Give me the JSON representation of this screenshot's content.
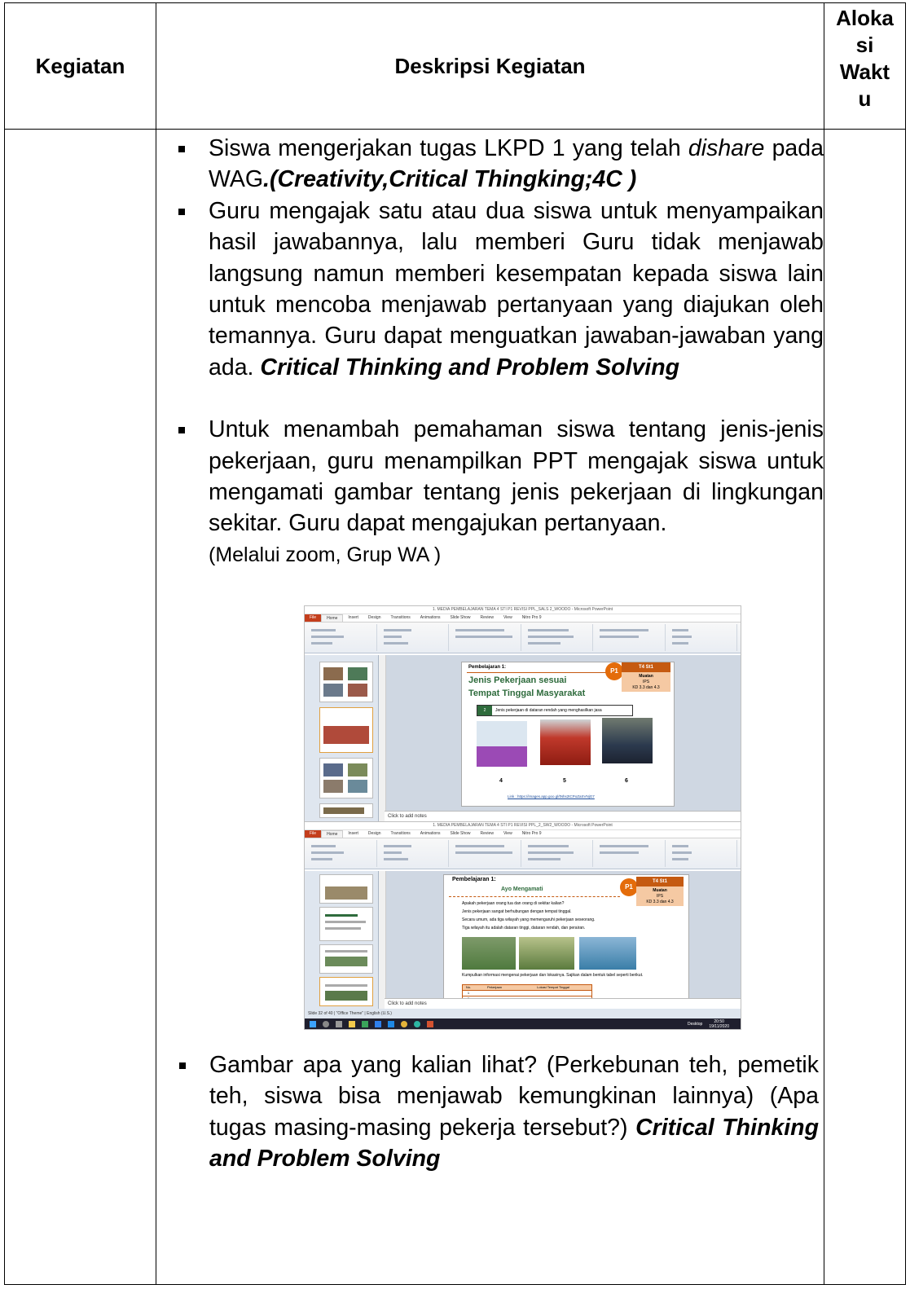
{
  "table": {
    "headers": {
      "kegiatan": "Kegiatan",
      "deskripsi": "Deskripsi Kegiatan",
      "alokasi": [
        "Aloka",
        "si",
        "Wakt",
        "u"
      ]
    },
    "items": {
      "item1": {
        "text1": "Siswa mengerjakan tugas LKPD 1 yang telah ",
        "italic": "dishare",
        "text2": " pada WAG",
        "bold_italic": ".(Creativity,Critical Thingking;4C )"
      },
      "item2": {
        "text": "Guru mengajak satu atau dua siswa untuk menyampaikan hasil jawabannya, lalu memberi Guru tidak menjawab langsung namun memberi kesempatan kepada siswa lain untuk mencoba menjawab pertanyaan yang diajukan oleh temannya. Guru dapat menguatkan jawaban-jawaban yang ada. ",
        "bold_italic": "Critical Thinking and Problem Solving"
      },
      "item3": {
        "text": "Untuk menambah pemahaman siswa tentang jenis-jenis pekerjaan, guru menampilkan PPT mengajak siswa untuk mengamati gambar tentang jenis pekerjaan di lingkungan sekitar. Guru dapat mengajukan pertanyaan.",
        "plain": "(Melalui zoom, Grup WA )"
      },
      "item4": {
        "text": "Gambar apa yang kalian lihat? (Perkebunan teh, pemetik teh, siswa bisa menjawab kemungkinan lainnya) (Apa tugas masing-masing pekerja tersebut?) ",
        "bold_italic": "Critical Thinking and Problem Solving"
      }
    }
  },
  "screenshot1": {
    "window_title": "1. MEDIA PEMBELAJARAN TEMA 4 STI P1 REVISI PPL_SALS 2_WOODO - Microsoft PowerPoint",
    "tabs": [
      "File",
      "Home",
      "Insert",
      "Design",
      "Transitions",
      "Animations",
      "Slide Show",
      "Review",
      "View",
      "Nitro Pro 9"
    ],
    "slide_label": "Pembelajaran 1:",
    "slide_title_line1": "Jenis Pekerjaan sesuai",
    "slide_title_line2": "Tempat Tinggal Masyarakat",
    "badge_header": "T4 St1",
    "badge_text1": "Muatan",
    "badge_text2": "IPS",
    "badge_text3": "KD 3.3 dan 4.3",
    "p1": "P1",
    "box_number": "2",
    "box_text": "Jenis pekerjaan di dataran rendah yang menghasilkan jasa",
    "numbers": [
      "4",
      "5",
      "6"
    ],
    "link": "Link : https://images.app.goo.gl/tNhs2tCPoZaSVNjG7",
    "notes": "Click to add notes"
  },
  "screenshot2": {
    "window_title": "1. MEDIA PEMBELAJARAN TEMA 4 STI P1 REVISI PPL_2_SW2_WOODO - Microsoft PowerPoint",
    "tabs": [
      "File",
      "Home",
      "Insert",
      "Design",
      "Transitions",
      "Animations",
      "Slide Show",
      "Review",
      "View",
      "Nitro Pro 9"
    ],
    "slide_label": "Pembelajaran 1:",
    "ayo": "Ayo Mengamati",
    "badge_header": "T4 St1",
    "badge_text1": "Muatan",
    "badge_text2": "IPS",
    "badge_text3": "KD 3.3 dan 4.3",
    "p1": "P1",
    "bullets": [
      "Apakah pekerjaan orang tua dan orang di sekitar kalian?",
      "Jenis pekerjaan sangat berhubungan dengan tempat tinggal.",
      "Secara umum, ada tiga wilayah yang memengaruhi pekerjaan seseorang.",
      "Tiga wilayah itu adalah dataran tinggi, dataran rendah, dan perairan."
    ],
    "para": "Kumpulkan informasi mengenai pekerjaan dan lokasinya. Sajikan dalam bentuk tabel seperti berikut.",
    "table_head": [
      "No.",
      "Pekerjaan",
      "Lokasi Tempat Tinggal"
    ],
    "table_rows": [
      "1",
      "2",
      "3"
    ],
    "notes": "Click to add notes",
    "status": "Slide 32 of 40 | \"Office Theme\" | English (U.S.)",
    "tray_time": "20:50",
    "tray_date": "19/11/2020",
    "tray_label": "Desktop"
  }
}
